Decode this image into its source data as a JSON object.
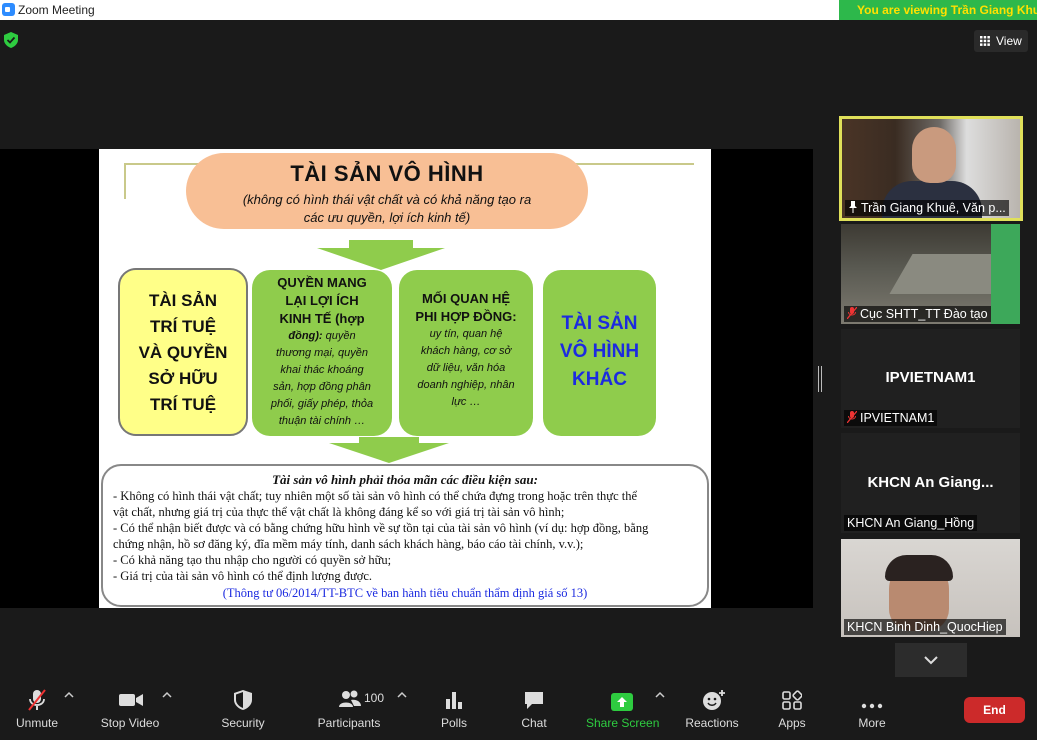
{
  "window": {
    "title": "Zoom Meeting"
  },
  "banner": {
    "viewing": "You are viewing Trần Giang Khuê's screen"
  },
  "view_button": {
    "label": "View"
  },
  "slide": {
    "title": "TÀI SẢN VÔ HÌNH",
    "subtitle_line1": "(không có hình thái vật chất và có khả năng tạo ra",
    "subtitle_line2": "các ưu quyền, lợi ích kinh tế)",
    "box1": [
      "TÀI SẢN",
      "TRÍ TUỆ",
      "VÀ QUYỀN",
      "SỞ HỮU",
      "TRÍ TUỆ"
    ],
    "box2_title": [
      "QUYỀN MANG",
      "LẠI LỢI ÍCH",
      "KINH TẾ (hợp",
      "đồng):"
    ],
    "box2_desc": [
      "quyền",
      "thương mại, quyền",
      "khai thác khoáng",
      "sản, hợp đồng phân",
      "phối, giấy phép, thỏa",
      "thuận tài chính …"
    ],
    "box3_title": [
      "MỐI QUAN HỆ",
      "PHI HỢP ĐỒNG:"
    ],
    "box3_desc": [
      "uy tín, quan hệ",
      "khách hàng, cơ sở",
      "dữ liệu, văn hóa",
      "doanh nghiệp, nhân",
      "lực …"
    ],
    "box4": [
      "TÀI SẢN",
      "VÔ HÌNH",
      "KHÁC"
    ],
    "conditions_heading": "Tài sản vô hình phải thỏa mãn các điều kiện sau:",
    "conditions": [
      "- Không có hình thái vật chất; tuy nhiên một số tài sản vô hình có thể chứa đựng trong hoặc trên thực thể",
      "vật chất, nhưng giá trị của thực thể vật chất là không đáng kể so với giá trị tài sản vô hình;",
      "- Có thể nhận biết được và có bằng chứng hữu hình về sự tồn tại của tài sản vô hình (ví dụ: hợp đồng, bằng",
      "chứng nhận, hồ sơ đăng ký, đĩa mềm máy tính, danh sách khách hàng, báo cáo tài chính, v.v.);",
      "- Có khả năng tạo thu nhập cho người có quyền sở hữu;",
      "- Giá trị của tài sản vô hình có thể định lượng được."
    ],
    "source": "(Thông tư 06/2014/TT-BTC về ban hành tiêu chuẩn thẩm định giá số 13)"
  },
  "participants": [
    {
      "name": "Trần Giang Khuê, Văn p...",
      "center": ""
    },
    {
      "name": "Cục SHTT_TT Đào tạo",
      "center": ""
    },
    {
      "name": "IPVIETNAM1",
      "center": "IPVIETNAM1"
    },
    {
      "name": "KHCN An Giang_Hồng",
      "center": "KHCN An Giang..."
    },
    {
      "name": "KHCN Binh Dinh_QuocHiep",
      "center": ""
    }
  ],
  "toolbar": {
    "unmute": "Unmute",
    "stop_video": "Stop Video",
    "security": "Security",
    "participants": "Participants",
    "participants_count": "100",
    "polls": "Polls",
    "chat": "Chat",
    "share_screen": "Share Screen",
    "reactions": "Reactions",
    "apps": "Apps",
    "more": "More",
    "end": "End"
  },
  "colors": {
    "share_green": "#2ecc40",
    "end_red": "#cc2a2a",
    "active_speaker": "#e0e05a"
  }
}
